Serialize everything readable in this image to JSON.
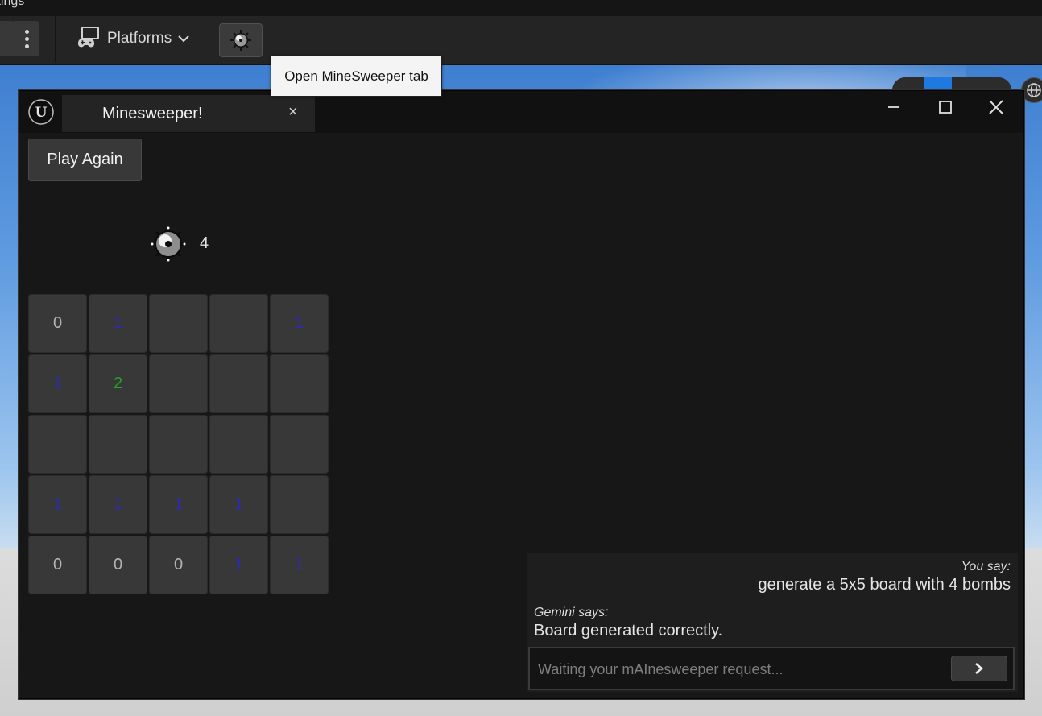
{
  "editor": {
    "menu_partial_label": "ttings",
    "toolbar": {
      "platforms_label": "Platforms",
      "minesweeper_button_tooltip": "Open MineSweeper tab"
    }
  },
  "window": {
    "tab_title": "Minesweeper!",
    "tab_close": "×"
  },
  "game": {
    "play_again_label": "Play Again",
    "bomb_count": "4",
    "colors": {
      "one": "#2d2bb0",
      "two": "#2aa12a",
      "zero": "#b4b4b4",
      "cell_bg": "#383838"
    },
    "board": [
      [
        "0",
        "1",
        "",
        "",
        "1"
      ],
      [
        "1",
        "2",
        "",
        "",
        ""
      ],
      [
        "",
        "",
        "",
        "",
        ""
      ],
      [
        "1",
        "1",
        "1",
        "1",
        ""
      ],
      [
        "0",
        "0",
        "0",
        "1",
        "1"
      ]
    ]
  },
  "chat": {
    "user_label": "You say:",
    "user_message": "generate a 5x5 board with 4 bombs",
    "bot_label": "Gemini says:",
    "bot_message": "Board generated correctly.",
    "input_placeholder": "Waiting your mAInesweeper request...",
    "input_value": ""
  },
  "icons": {
    "toolbar": [
      "kebab-menu-icon",
      "controller-icon",
      "chevron-down-icon",
      "mine-icon"
    ],
    "window": [
      "unreal-logo-icon",
      "minimize-icon",
      "maximize-icon",
      "close-icon"
    ],
    "chat": [
      "chevron-right-icon"
    ]
  }
}
